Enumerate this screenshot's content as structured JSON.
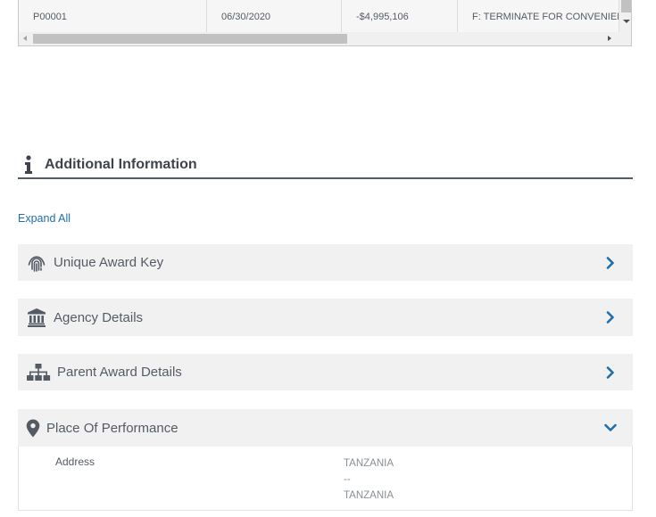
{
  "table": {
    "row": {
      "modification": "P00001",
      "date": "06/30/2020",
      "amount": "-$4,995,106",
      "action": "F: TERMINATE FOR CONVENIENC"
    }
  },
  "section": {
    "title": "Additional Information",
    "icon": "info-icon"
  },
  "expand_all": "Expand All",
  "panels": [
    {
      "label": "Unique Award Key",
      "icon": "fingerprint-icon",
      "state": "collapsed"
    },
    {
      "label": "Agency Details",
      "icon": "bank-building-icon",
      "state": "collapsed"
    },
    {
      "label": "Parent Award Details",
      "icon": "sitemap-icon",
      "state": "collapsed"
    },
    {
      "label": "Place Of Performance",
      "icon": "map-marker-icon",
      "state": "expanded"
    }
  ],
  "place_of_performance": {
    "address_label": "Address",
    "address_lines": [
      "TANZANIA",
      "--",
      "TANZANIA"
    ]
  },
  "colors": {
    "accent": "#1f6ead",
    "panel_bg": "#f1f1f1",
    "heading_rule": "#555b65"
  }
}
